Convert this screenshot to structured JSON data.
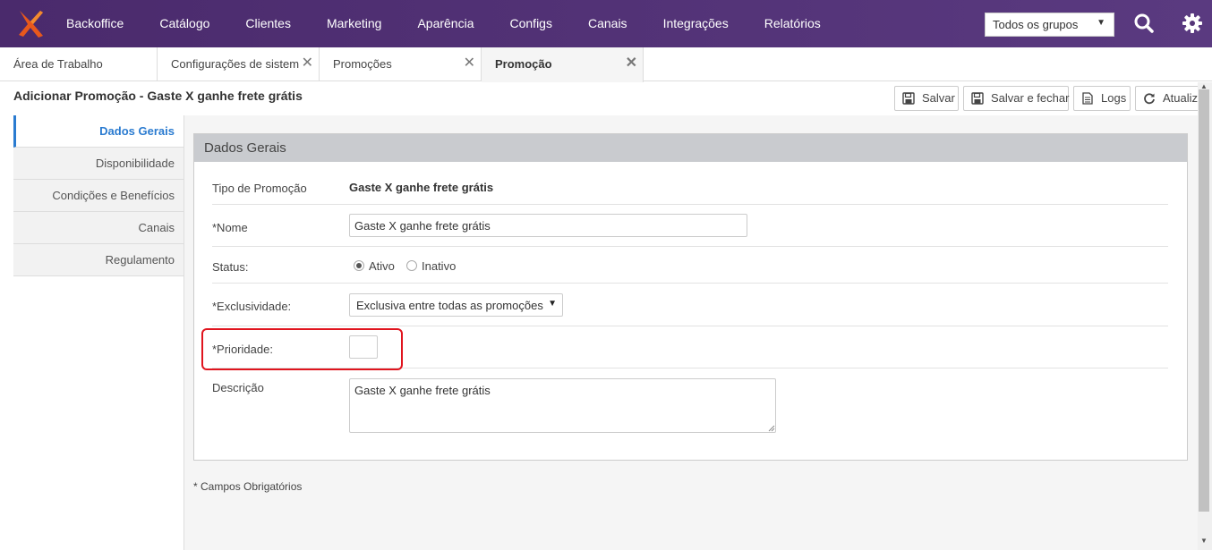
{
  "nav": {
    "items": [
      "Backoffice",
      "Catálogo",
      "Clientes",
      "Marketing",
      "Aparência",
      "Configs",
      "Canais",
      "Integrações",
      "Relatórios"
    ],
    "group_select": "Todos os grupos"
  },
  "tabs": [
    {
      "label": "Área de Trabalho"
    },
    {
      "label": "Configurações de sistema"
    },
    {
      "label": "Promoções"
    },
    {
      "label": "Promoção"
    }
  ],
  "page": {
    "title": "Adicionar Promoção - Gaste X ganhe frete grátis"
  },
  "toolbar": {
    "save": "Salvar",
    "save_close": "Salvar e fechar",
    "logs": "Logs",
    "refresh": "Atualizar"
  },
  "sidemenu": {
    "items": [
      "Dados Gerais",
      "Disponibilidade",
      "Condições e Benefícios",
      "Canais",
      "Regulamento"
    ]
  },
  "form": {
    "panel_title": "Dados Gerais",
    "tipo_label": "Tipo de Promoção",
    "tipo_value": "Gaste X ganhe frete grátis",
    "nome_label": "*Nome",
    "nome_value": "Gaste X ganhe frete grátis",
    "status_label": "Status:",
    "status_ativo": "Ativo",
    "status_inativo": "Inativo",
    "exclusividade_label": "*Exclusividade:",
    "exclusividade_value": "Exclusiva entre todas as promoções",
    "prioridade_label": "*Prioridade:",
    "prioridade_value": "",
    "descricao_label": "Descrição",
    "descricao_value": "Gaste X ganhe frete grátis"
  },
  "footer_note": "* Campos Obrigatórios"
}
